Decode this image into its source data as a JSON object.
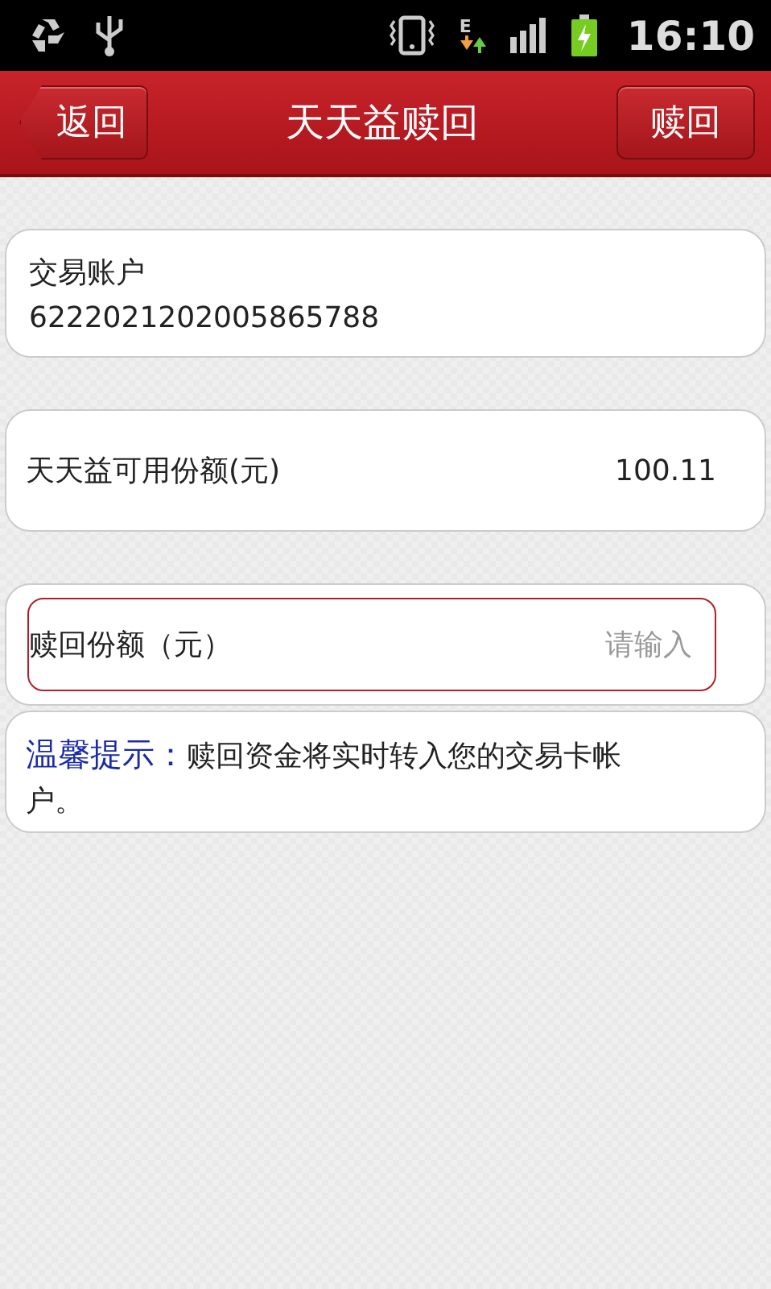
{
  "status_bar": {
    "network_letter": "E",
    "time": "16:10"
  },
  "title_bar": {
    "back_button": "返回",
    "title": "天天益赎回",
    "action_button": "赎回"
  },
  "account": {
    "label": "交易账户",
    "number": "6222021202005865788"
  },
  "available": {
    "label": "天天益可用份额(元)",
    "value": "100.11"
  },
  "amount_field": {
    "label": "赎回份额（元）",
    "placeholder": "请输入"
  },
  "tip": {
    "label": "温馨提示：",
    "text": "赎回资金将实时转入您的交易卡帐户。"
  }
}
